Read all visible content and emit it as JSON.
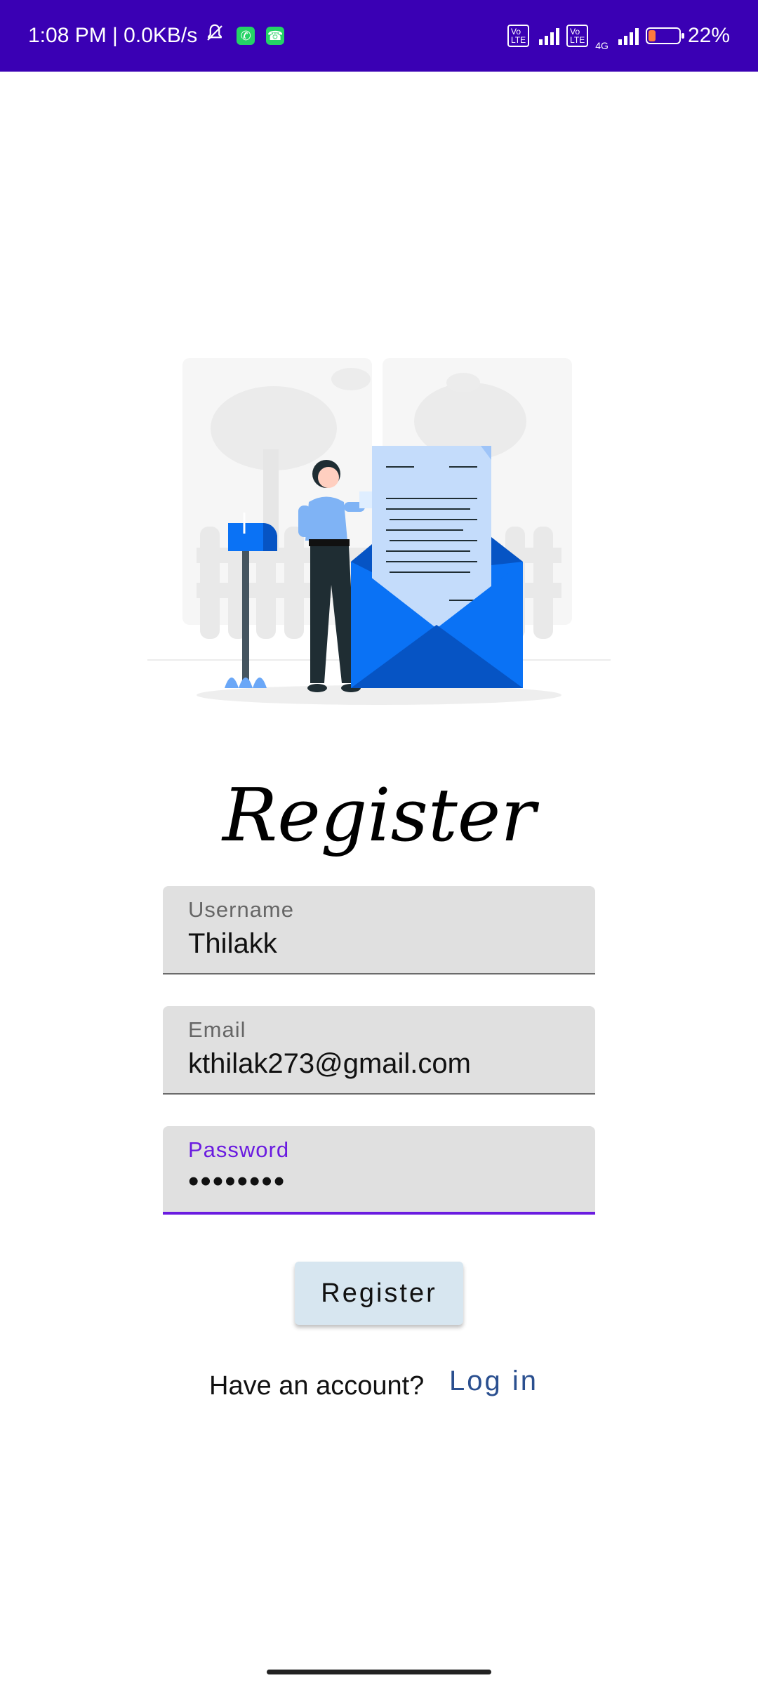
{
  "status_bar": {
    "time": "1:08 PM | 0.0KB/s",
    "network": "4G",
    "battery": "22%",
    "battery_level": 0.22,
    "icons": [
      "bell-off-icon",
      "whatsapp-icon",
      "call-icon",
      "volte-icon",
      "signal-icon",
      "battery-icon"
    ]
  },
  "illustration": {
    "name": "woman-reading-letter-illustration",
    "accent_color": "#0a72f5"
  },
  "title": "Register",
  "fields": {
    "username": {
      "label": "Username",
      "value": "Thilakk"
    },
    "email": {
      "label": "Email",
      "value": "kthilak273@gmail.com"
    },
    "password": {
      "label": "Password",
      "value": "••••••••",
      "focused": true
    }
  },
  "register_button": "Register",
  "login_prompt": {
    "text": "Have an account?",
    "link": "Log in"
  },
  "colors": {
    "status_bar": "#3a00b4",
    "focus": "#6a1be0",
    "field_bg": "#e0e0e0",
    "button_bg": "#d7e6f0",
    "link": "#2a4f8f"
  }
}
